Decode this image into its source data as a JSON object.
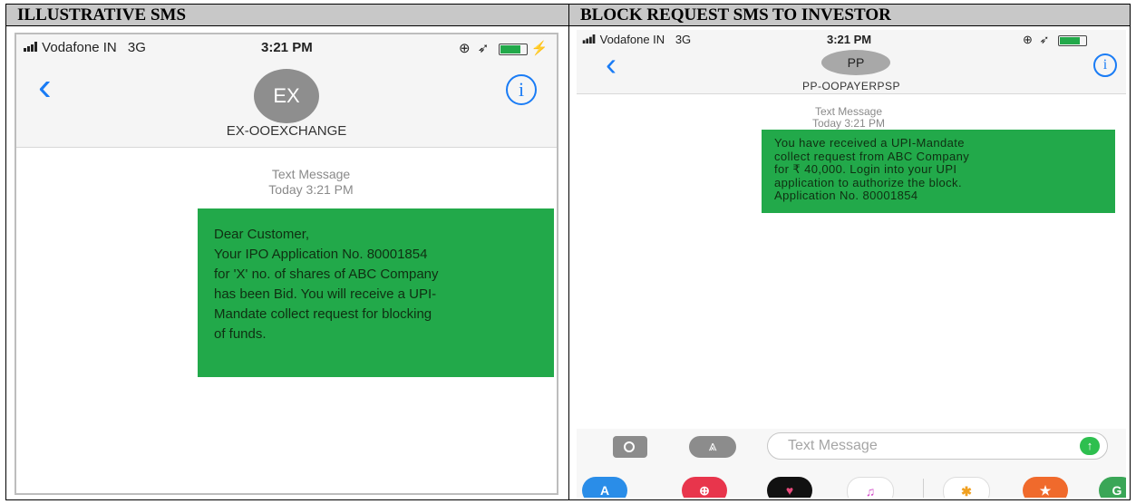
{
  "headers": {
    "left": "ILLUSTRATIVE SMS",
    "right": "BLOCK REQUEST SMS TO INVESTOR"
  },
  "left_phone": {
    "status": {
      "carrier": "Vodafone IN",
      "network": "3G",
      "time": "3:21 PM"
    },
    "contact": {
      "initials": "EX",
      "name": "EX-OOEXCHANGE"
    },
    "meta": {
      "label": "Text Message",
      "timestamp": "Today 3:21 PM"
    },
    "message": {
      "line1": "Dear Customer,",
      "line2": "Your IPO Application No. 80001854",
      "line3": "for 'X' no. of shares of ABC Company",
      "line4": "has been Bid. You will receive a UPI-",
      "line5": "Mandate collect request for blocking",
      "line6": "of funds."
    }
  },
  "right_phone": {
    "status": {
      "carrier": "Vodafone IN",
      "network": "3G",
      "time": "3:21 PM"
    },
    "contact": {
      "initials": "PP",
      "name": "PP-OOPAYERPSP"
    },
    "meta": {
      "label": "Text Message",
      "timestamp": "Today 3:21 PM"
    },
    "message": {
      "line1": "You have received a UPI-Mandate",
      "line2": "collect request from ABC Company",
      "line3": "for ₹ 40,000. Login into your UPI",
      "line4": "application to authorize the block.",
      "line5": "Application No. 80001854"
    },
    "compose": {
      "placeholder": "Text Message"
    },
    "app_icons": [
      "app-store-icon",
      "web-search-icon",
      "digital-touch-icon",
      "music-icon",
      "photos-icon",
      "game-icon",
      "maps-icon"
    ]
  },
  "colors": {
    "header_bg": "#c8c8c8",
    "bubble_green": "#22a94a",
    "ios_blue": "#1a7cf5",
    "send_green": "#2ebf4f"
  }
}
